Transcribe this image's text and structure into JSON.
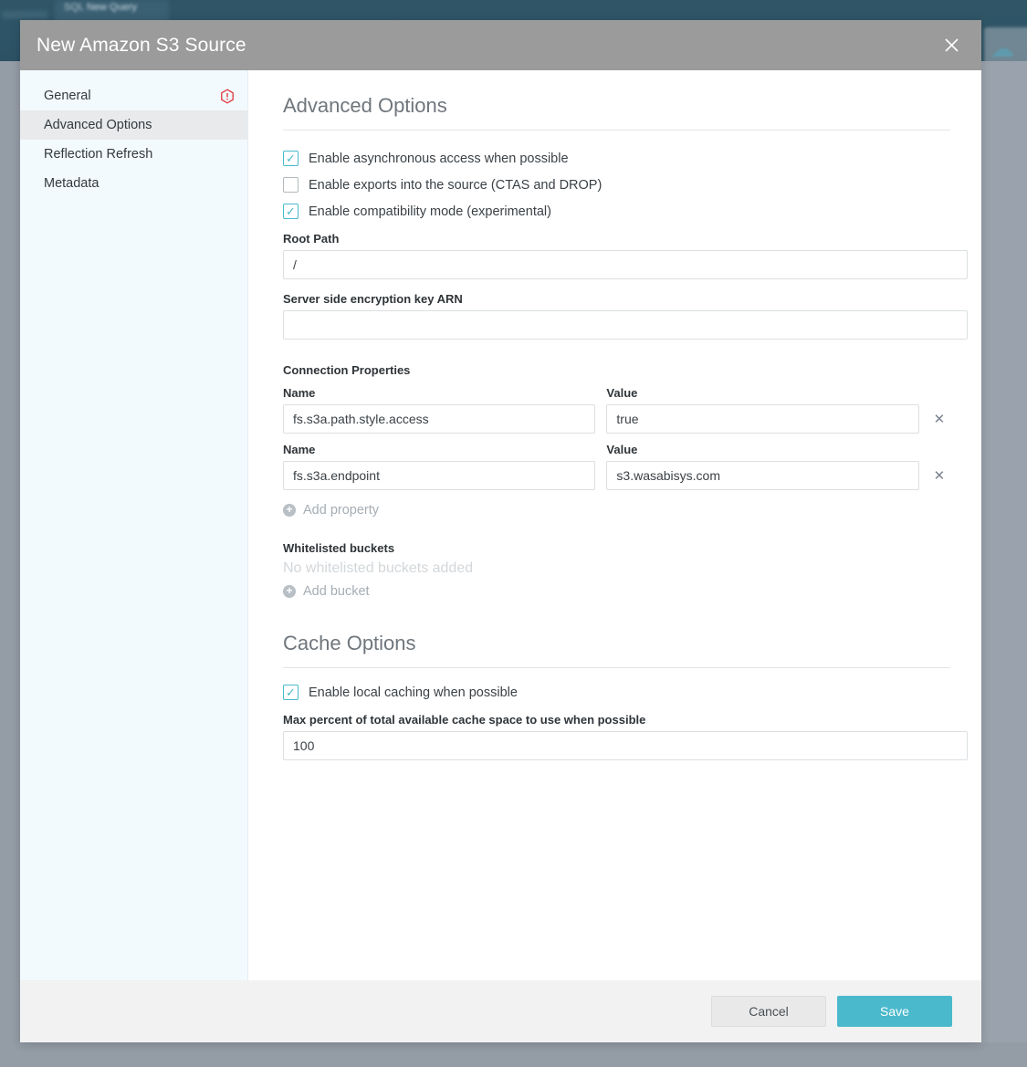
{
  "background": {
    "tab_label": "New Query",
    "tab_icon": "sql-icon",
    "actions_label": "Actions",
    "cloud_icon": "cloud-upload-icon"
  },
  "modal": {
    "title": "New Amazon S3 Source",
    "close_icon": "close-icon",
    "sidebar": {
      "items": [
        {
          "label": "General",
          "selected": false,
          "error": true,
          "error_icon": "error-hexagon-icon"
        },
        {
          "label": "Advanced Options",
          "selected": true,
          "error": false
        },
        {
          "label": "Reflection Refresh",
          "selected": false,
          "error": false
        },
        {
          "label": "Metadata",
          "selected": false,
          "error": false
        }
      ]
    },
    "advanced": {
      "heading": "Advanced Options",
      "checkboxes": [
        {
          "label": "Enable asynchronous access when possible",
          "checked": true
        },
        {
          "label": "Enable exports into the source (CTAS and DROP)",
          "checked": false
        },
        {
          "label": "Enable compatibility mode (experimental)",
          "checked": true
        }
      ],
      "root_path": {
        "label": "Root Path",
        "value": "/",
        "placeholder": ""
      },
      "sse_key_arn": {
        "label": "Server side encryption key ARN",
        "value": "",
        "placeholder": ""
      },
      "connection_properties": {
        "label": "Connection Properties",
        "name_header": "Name",
        "value_header": "Value",
        "remove_icon": "remove-x-icon",
        "rows": [
          {
            "name": "fs.s3a.path.style.access",
            "value": "true"
          },
          {
            "name": "fs.s3a.endpoint",
            "value": "s3.wasabisys.com"
          }
        ],
        "add_label": "Add property",
        "add_icon": "plus-circle-icon"
      },
      "whitelisted_buckets": {
        "label": "Whitelisted buckets",
        "empty_text": "No whitelisted buckets added",
        "add_label": "Add bucket",
        "add_icon": "plus-circle-icon"
      }
    },
    "cache": {
      "heading": "Cache Options",
      "checkbox": {
        "label": "Enable local caching when possible",
        "checked": true
      },
      "max_percent": {
        "label": "Max percent of total available cache space to use when possible",
        "value": "100"
      }
    },
    "footer": {
      "cancel_label": "Cancel",
      "save_label": "Save"
    }
  },
  "colors": {
    "accent_teal": "#4ab9cc",
    "header_gray": "#9b9b9b",
    "error_red": "#e0383e",
    "sidebar_bg": "#f2fafd",
    "selected_bg": "#e8eaec"
  }
}
